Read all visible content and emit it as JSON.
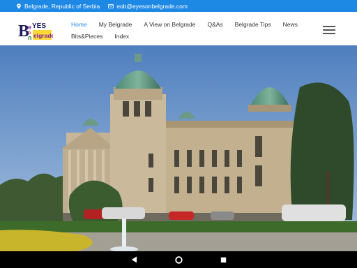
{
  "topbar": {
    "location": "Belgrade, Republic of Serbia",
    "email": "eob@eyesonbelgrade.com",
    "location_icon": "location-pin-icon",
    "email_icon": "envelope-icon",
    "bg_color": "#1e88e5"
  },
  "logo": {
    "letters": [
      "B",
      "e",
      "EYES",
      "o",
      "n",
      "Belgrade"
    ]
  },
  "nav": {
    "row1": [
      "Home",
      "My Belgrade",
      "A View on Belgrade",
      "Q&As",
      "Belgrade Tips",
      "News"
    ],
    "row2": [
      "Bits&Pieces",
      "Index"
    ],
    "active": "Home",
    "active_color": "#1e88e5"
  },
  "system_nav": {
    "back_icon": "back-triangle-icon",
    "home_icon": "home-circle-icon",
    "recents_icon": "recents-square-icon"
  }
}
